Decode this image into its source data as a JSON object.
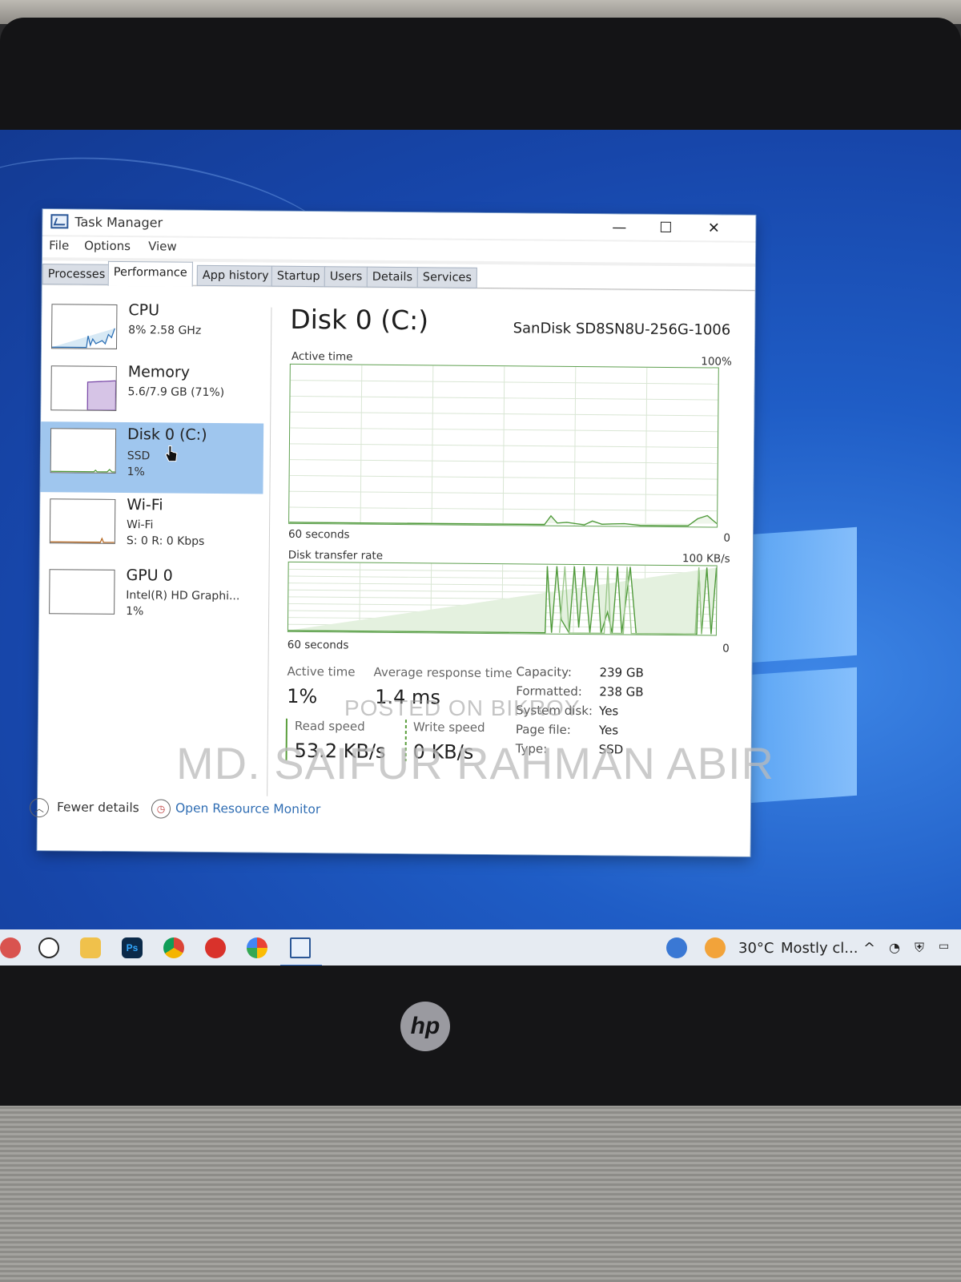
{
  "window": {
    "title": "Task Manager",
    "controls": {
      "minimize": "—",
      "maximize": "☐",
      "close": "✕"
    }
  },
  "menu": [
    "File",
    "Options",
    "View"
  ],
  "tabs": [
    {
      "label": "Processes"
    },
    {
      "label": "Performance",
      "active": true
    },
    {
      "label": "App history"
    },
    {
      "label": "Startup"
    },
    {
      "label": "Users"
    },
    {
      "label": "Details"
    },
    {
      "label": "Services"
    }
  ],
  "sidebar": [
    {
      "name": "CPU",
      "line1": "8% 2.58 GHz",
      "line2": ""
    },
    {
      "name": "Memory",
      "line1": "5.6/7.9 GB (71%)",
      "line2": ""
    },
    {
      "name": "Disk 0 (C:)",
      "line1": "SSD",
      "line2": "1%",
      "selected": true
    },
    {
      "name": "Wi-Fi",
      "line1": "Wi-Fi",
      "line2": "S: 0 R: 0 Kbps"
    },
    {
      "name": "GPU 0",
      "line1": "Intel(R) HD Graphi...",
      "line2": "1%"
    }
  ],
  "disk": {
    "title": "Disk 0 (C:)",
    "model": "SanDisk SD8SN8U-256G-1006",
    "active_graph": {
      "label": "Active time",
      "max": "100%",
      "time": "60 seconds",
      "min": "0"
    },
    "transfer_graph": {
      "label": "Disk transfer rate",
      "max": "100 KB/s",
      "time": "60 seconds",
      "min": "0"
    },
    "stats": {
      "active_time_label": "Active time",
      "active_time_value": "1%",
      "response_label": "Average response time",
      "response_value": "1.4 ms",
      "read_label": "Read speed",
      "read_value": "53.2 KB/s",
      "write_label": "Write speed",
      "write_value": "0 KB/s"
    },
    "properties": [
      {
        "label": "Capacity:",
        "value": "239 GB"
      },
      {
        "label": "Formatted:",
        "value": "238 GB"
      },
      {
        "label": "System disk:",
        "value": "Yes"
      },
      {
        "label": "Page file:",
        "value": "Yes"
      },
      {
        "label": "Type:",
        "value": "SSD"
      }
    ]
  },
  "footer": {
    "fewer_details": "Fewer details",
    "resource_monitor": "Open Resource Monitor"
  },
  "watermarks": {
    "small": "POSTED ON BIKROY",
    "large": "MD. SAIFUR RAHMAN ABIR"
  },
  "taskbar": {
    "icons": [
      "help-icon",
      "whatsapp-icon",
      "file-explorer-icon",
      "photoshop-icon",
      "chrome-icon",
      "wps-office-icon",
      "color-app-icon",
      "task-manager-icon"
    ],
    "photoshop_label": "Ps",
    "weather_temp": "30°C",
    "weather_text": "Mostly cl...",
    "tray_chevron": "^"
  },
  "device": {
    "brand": "hp"
  },
  "colors": {
    "selection": "#9fc6ee",
    "graph_line": "#4f9a3a",
    "link": "#2f6db3",
    "desktop": "#1f5dc6"
  }
}
